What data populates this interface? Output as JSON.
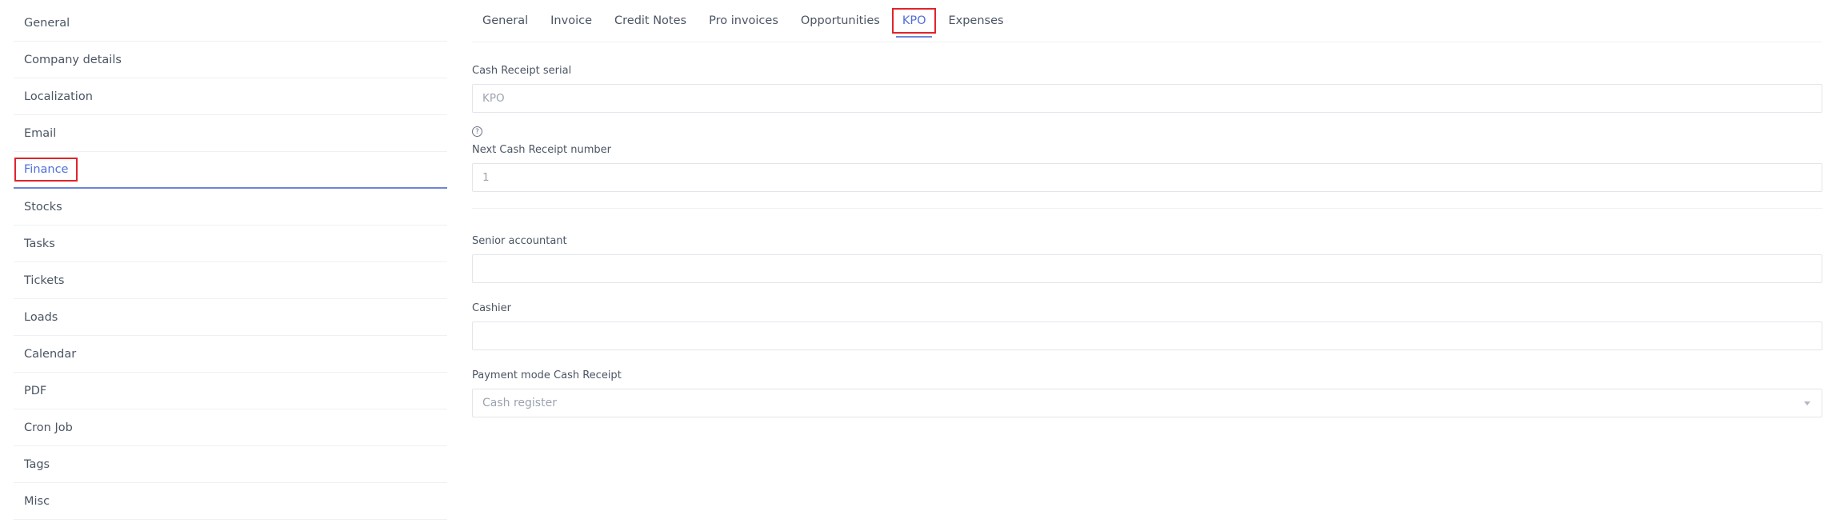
{
  "sidebar": {
    "items": [
      {
        "label": "General"
      },
      {
        "label": "Company details"
      },
      {
        "label": "Localization"
      },
      {
        "label": "Email"
      },
      {
        "label": "Finance",
        "active": true
      },
      {
        "label": "Stocks"
      },
      {
        "label": "Tasks"
      },
      {
        "label": "Tickets"
      },
      {
        "label": "Loads"
      },
      {
        "label": "Calendar"
      },
      {
        "label": "PDF"
      },
      {
        "label": "Cron Job"
      },
      {
        "label": "Tags"
      },
      {
        "label": "Misc"
      }
    ]
  },
  "tabs": [
    {
      "label": "General"
    },
    {
      "label": "Invoice"
    },
    {
      "label": "Credit Notes"
    },
    {
      "label": "Pro invoices"
    },
    {
      "label": "Opportunities"
    },
    {
      "label": "KPO",
      "active": true
    },
    {
      "label": "Expenses"
    }
  ],
  "form": {
    "serial": {
      "label": "Cash Receipt serial",
      "placeholder": "KPO"
    },
    "help_icon": "question-circle-icon",
    "next_number": {
      "label": "Next Cash Receipt number",
      "placeholder": "1"
    },
    "senior_accountant": {
      "label": "Senior accountant",
      "value": ""
    },
    "cashier": {
      "label": "Cashier",
      "value": ""
    },
    "payment_mode": {
      "label": "Payment mode Cash Receipt",
      "selected": "Cash register"
    }
  },
  "colors": {
    "accent": "#4f6fd8",
    "highlight_outline": "#e0242a",
    "border": "#e2e5ea"
  }
}
